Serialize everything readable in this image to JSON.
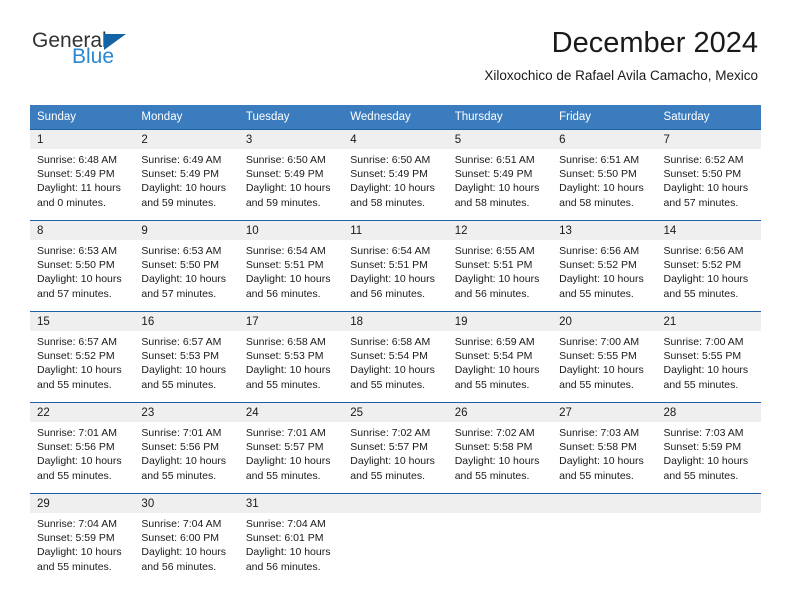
{
  "brand": {
    "name_top": "General",
    "name_bottom": "Blue",
    "accent_color": "#2a87d0",
    "triangle_color": "#1464a5"
  },
  "header": {
    "title": "December 2024",
    "subtitle": "Xiloxochico de Rafael Avila Camacho, Mexico"
  },
  "theme": {
    "header_row_bg": "#3a7cbe",
    "header_row_text": "#ffffff",
    "daynum_band_bg": "#efefef",
    "row_divider": "#1f5fa3"
  },
  "weekdays": [
    "Sunday",
    "Monday",
    "Tuesday",
    "Wednesday",
    "Thursday",
    "Friday",
    "Saturday"
  ],
  "weeks": [
    {
      "days": [
        {
          "num": "1",
          "sunrise": "Sunrise: 6:48 AM",
          "sunset": "Sunset: 5:49 PM",
          "daylight1": "Daylight: 11 hours",
          "daylight2": "and 0 minutes."
        },
        {
          "num": "2",
          "sunrise": "Sunrise: 6:49 AM",
          "sunset": "Sunset: 5:49 PM",
          "daylight1": "Daylight: 10 hours",
          "daylight2": "and 59 minutes."
        },
        {
          "num": "3",
          "sunrise": "Sunrise: 6:50 AM",
          "sunset": "Sunset: 5:49 PM",
          "daylight1": "Daylight: 10 hours",
          "daylight2": "and 59 minutes."
        },
        {
          "num": "4",
          "sunrise": "Sunrise: 6:50 AM",
          "sunset": "Sunset: 5:49 PM",
          "daylight1": "Daylight: 10 hours",
          "daylight2": "and 58 minutes."
        },
        {
          "num": "5",
          "sunrise": "Sunrise: 6:51 AM",
          "sunset": "Sunset: 5:49 PM",
          "daylight1": "Daylight: 10 hours",
          "daylight2": "and 58 minutes."
        },
        {
          "num": "6",
          "sunrise": "Sunrise: 6:51 AM",
          "sunset": "Sunset: 5:50 PM",
          "daylight1": "Daylight: 10 hours",
          "daylight2": "and 58 minutes."
        },
        {
          "num": "7",
          "sunrise": "Sunrise: 6:52 AM",
          "sunset": "Sunset: 5:50 PM",
          "daylight1": "Daylight: 10 hours",
          "daylight2": "and 57 minutes."
        }
      ]
    },
    {
      "days": [
        {
          "num": "8",
          "sunrise": "Sunrise: 6:53 AM",
          "sunset": "Sunset: 5:50 PM",
          "daylight1": "Daylight: 10 hours",
          "daylight2": "and 57 minutes."
        },
        {
          "num": "9",
          "sunrise": "Sunrise: 6:53 AM",
          "sunset": "Sunset: 5:50 PM",
          "daylight1": "Daylight: 10 hours",
          "daylight2": "and 57 minutes."
        },
        {
          "num": "10",
          "sunrise": "Sunrise: 6:54 AM",
          "sunset": "Sunset: 5:51 PM",
          "daylight1": "Daylight: 10 hours",
          "daylight2": "and 56 minutes."
        },
        {
          "num": "11",
          "sunrise": "Sunrise: 6:54 AM",
          "sunset": "Sunset: 5:51 PM",
          "daylight1": "Daylight: 10 hours",
          "daylight2": "and 56 minutes."
        },
        {
          "num": "12",
          "sunrise": "Sunrise: 6:55 AM",
          "sunset": "Sunset: 5:51 PM",
          "daylight1": "Daylight: 10 hours",
          "daylight2": "and 56 minutes."
        },
        {
          "num": "13",
          "sunrise": "Sunrise: 6:56 AM",
          "sunset": "Sunset: 5:52 PM",
          "daylight1": "Daylight: 10 hours",
          "daylight2": "and 55 minutes."
        },
        {
          "num": "14",
          "sunrise": "Sunrise: 6:56 AM",
          "sunset": "Sunset: 5:52 PM",
          "daylight1": "Daylight: 10 hours",
          "daylight2": "and 55 minutes."
        }
      ]
    },
    {
      "days": [
        {
          "num": "15",
          "sunrise": "Sunrise: 6:57 AM",
          "sunset": "Sunset: 5:52 PM",
          "daylight1": "Daylight: 10 hours",
          "daylight2": "and 55 minutes."
        },
        {
          "num": "16",
          "sunrise": "Sunrise: 6:57 AM",
          "sunset": "Sunset: 5:53 PM",
          "daylight1": "Daylight: 10 hours",
          "daylight2": "and 55 minutes."
        },
        {
          "num": "17",
          "sunrise": "Sunrise: 6:58 AM",
          "sunset": "Sunset: 5:53 PM",
          "daylight1": "Daylight: 10 hours",
          "daylight2": "and 55 minutes."
        },
        {
          "num": "18",
          "sunrise": "Sunrise: 6:58 AM",
          "sunset": "Sunset: 5:54 PM",
          "daylight1": "Daylight: 10 hours",
          "daylight2": "and 55 minutes."
        },
        {
          "num": "19",
          "sunrise": "Sunrise: 6:59 AM",
          "sunset": "Sunset: 5:54 PM",
          "daylight1": "Daylight: 10 hours",
          "daylight2": "and 55 minutes."
        },
        {
          "num": "20",
          "sunrise": "Sunrise: 7:00 AM",
          "sunset": "Sunset: 5:55 PM",
          "daylight1": "Daylight: 10 hours",
          "daylight2": "and 55 minutes."
        },
        {
          "num": "21",
          "sunrise": "Sunrise: 7:00 AM",
          "sunset": "Sunset: 5:55 PM",
          "daylight1": "Daylight: 10 hours",
          "daylight2": "and 55 minutes."
        }
      ]
    },
    {
      "days": [
        {
          "num": "22",
          "sunrise": "Sunrise: 7:01 AM",
          "sunset": "Sunset: 5:56 PM",
          "daylight1": "Daylight: 10 hours",
          "daylight2": "and 55 minutes."
        },
        {
          "num": "23",
          "sunrise": "Sunrise: 7:01 AM",
          "sunset": "Sunset: 5:56 PM",
          "daylight1": "Daylight: 10 hours",
          "daylight2": "and 55 minutes."
        },
        {
          "num": "24",
          "sunrise": "Sunrise: 7:01 AM",
          "sunset": "Sunset: 5:57 PM",
          "daylight1": "Daylight: 10 hours",
          "daylight2": "and 55 minutes."
        },
        {
          "num": "25",
          "sunrise": "Sunrise: 7:02 AM",
          "sunset": "Sunset: 5:57 PM",
          "daylight1": "Daylight: 10 hours",
          "daylight2": "and 55 minutes."
        },
        {
          "num": "26",
          "sunrise": "Sunrise: 7:02 AM",
          "sunset": "Sunset: 5:58 PM",
          "daylight1": "Daylight: 10 hours",
          "daylight2": "and 55 minutes."
        },
        {
          "num": "27",
          "sunrise": "Sunrise: 7:03 AM",
          "sunset": "Sunset: 5:58 PM",
          "daylight1": "Daylight: 10 hours",
          "daylight2": "and 55 minutes."
        },
        {
          "num": "28",
          "sunrise": "Sunrise: 7:03 AM",
          "sunset": "Sunset: 5:59 PM",
          "daylight1": "Daylight: 10 hours",
          "daylight2": "and 55 minutes."
        }
      ]
    },
    {
      "days": [
        {
          "num": "29",
          "sunrise": "Sunrise: 7:04 AM",
          "sunset": "Sunset: 5:59 PM",
          "daylight1": "Daylight: 10 hours",
          "daylight2": "and 55 minutes."
        },
        {
          "num": "30",
          "sunrise": "Sunrise: 7:04 AM",
          "sunset": "Sunset: 6:00 PM",
          "daylight1": "Daylight: 10 hours",
          "daylight2": "and 56 minutes."
        },
        {
          "num": "31",
          "sunrise": "Sunrise: 7:04 AM",
          "sunset": "Sunset: 6:01 PM",
          "daylight1": "Daylight: 10 hours",
          "daylight2": "and 56 minutes."
        },
        {
          "num": "",
          "sunrise": "",
          "sunset": "",
          "daylight1": "",
          "daylight2": ""
        },
        {
          "num": "",
          "sunrise": "",
          "sunset": "",
          "daylight1": "",
          "daylight2": ""
        },
        {
          "num": "",
          "sunrise": "",
          "sunset": "",
          "daylight1": "",
          "daylight2": ""
        },
        {
          "num": "",
          "sunrise": "",
          "sunset": "",
          "daylight1": "",
          "daylight2": ""
        }
      ]
    }
  ]
}
